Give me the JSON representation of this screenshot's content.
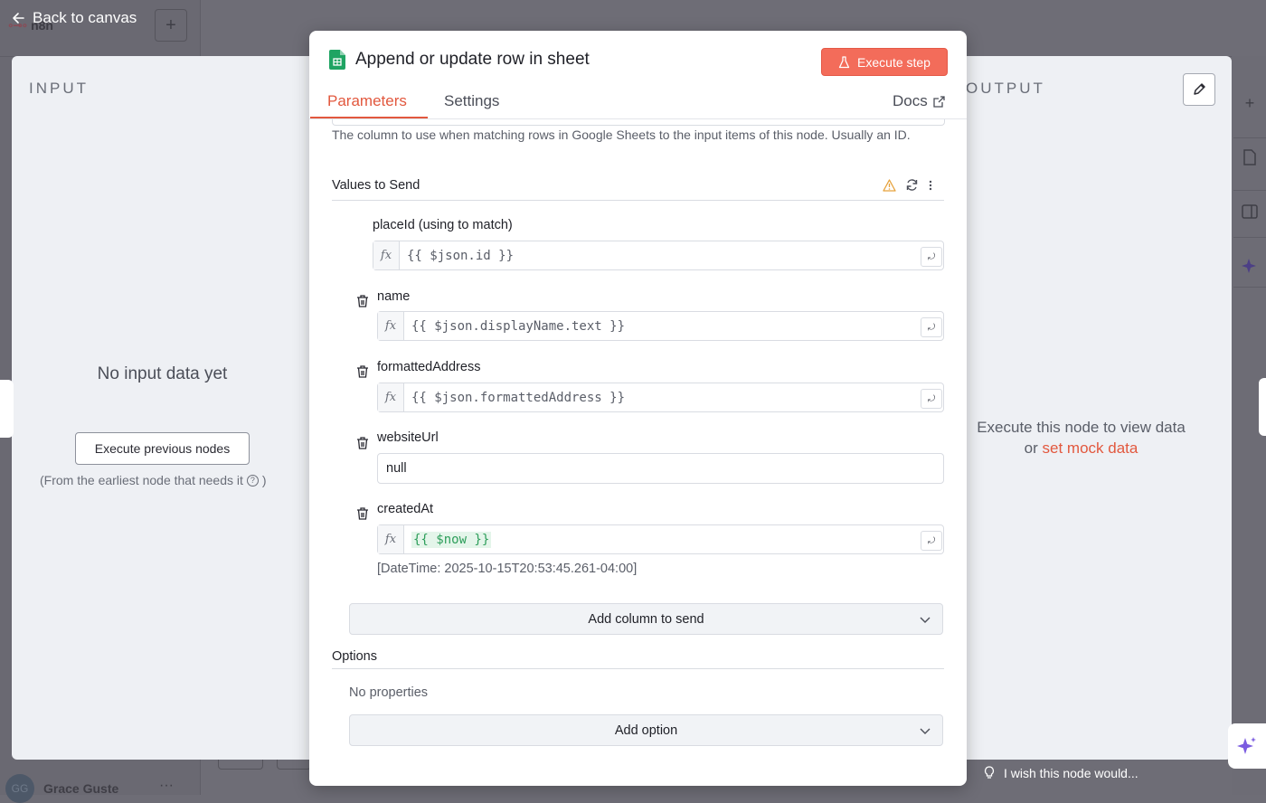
{
  "app": {
    "brand": "n8n",
    "back_label": "Back to canvas",
    "user_initials": "GG",
    "user_name": "Grace Guste",
    "more": "···"
  },
  "input_panel": {
    "title": "INPUT",
    "empty_message": "No input data yet",
    "execute_previous_label": "Execute previous nodes",
    "note_prefix": "(From the earliest node that needs it",
    "note_suffix": ")"
  },
  "output_panel": {
    "title": "OUTPUT",
    "message_line1": "Execute this node to view data",
    "message_prefix": "or",
    "mock_link": "set mock data"
  },
  "modal": {
    "title": "Append or update row in sheet",
    "execute_step_label": "Execute step",
    "tabs": [
      "Parameters",
      "Settings"
    ],
    "docs_label": "Docs",
    "hint": "The column to use when matching rows in Google Sheets to the input items of this node. Usually an ID.",
    "values_section_title": "Values to Send",
    "fields": [
      {
        "label": "placeId (using to match)",
        "fx": "fx",
        "value": "{{ $json.id }}"
      },
      {
        "label": "name",
        "fx": "fx",
        "value": "{{ $json.displayName.text }}"
      },
      {
        "label": "formattedAddress",
        "fx": "fx",
        "value": "{{ $json.formattedAddress }}"
      },
      {
        "label": "websiteUrl",
        "value": "null"
      },
      {
        "label": "createdAt",
        "fx": "fx",
        "value": "{{ $now }}",
        "preview": "[DateTime: 2025-10-15T20:53:45.261-04:00]"
      }
    ],
    "add_column_label": "Add column to send",
    "options_section_title": "Options",
    "no_properties": "No properties",
    "add_option_label": "Add option"
  },
  "footer": {
    "wish_label": "I wish this node would..."
  },
  "colors": {
    "accent": "#e2583e",
    "execute_button": "#f36c5a",
    "sheets_green": "#1fa463",
    "expression_green": "#2e9e5b"
  },
  "icons": [
    "arrow-left-icon",
    "plus-icon",
    "google-sheets-icon",
    "flask-icon",
    "external-link-icon",
    "warning-icon",
    "refresh-icon",
    "more-vertical-icon",
    "trash-icon",
    "open-expression-icon",
    "chevron-down-icon",
    "pencil-icon",
    "help-icon",
    "lightbulb-icon",
    "sparkle-icon"
  ]
}
